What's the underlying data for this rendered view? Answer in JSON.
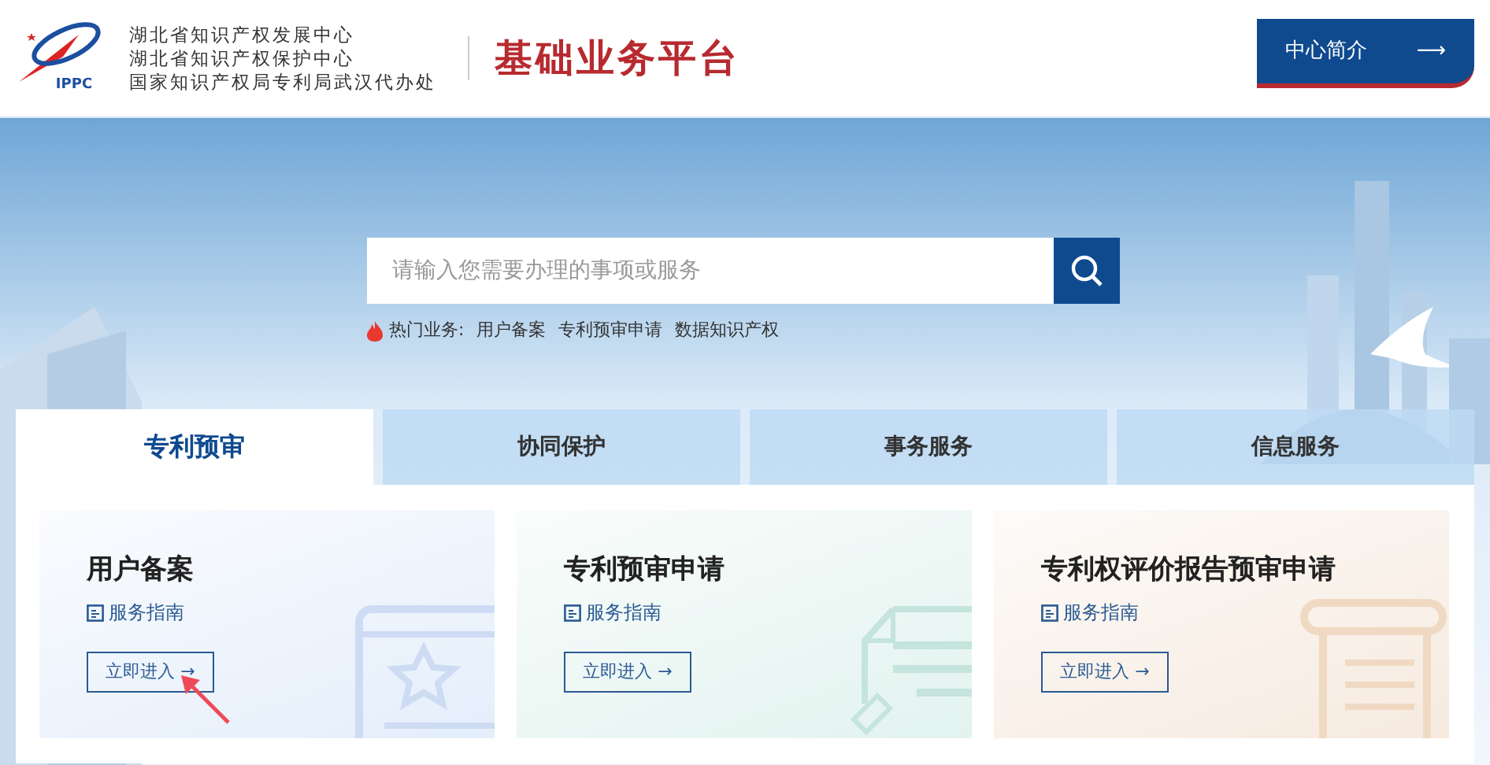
{
  "header": {
    "logo_text": "IPPC",
    "org_lines": [
      "湖北省知识产权发展中心",
      "湖北省知识产权保护中心",
      "国家知识产权局专利局武汉代办处"
    ],
    "platform_title": "基础业务平台",
    "intro_button": "中心简介",
    "intro_arrow": "⟶"
  },
  "search": {
    "placeholder": "请输入您需要办理的事项或服务"
  },
  "hot": {
    "label": "热门业务:",
    "links": [
      "用户备案",
      "专利预审申请",
      "数据知识产权"
    ]
  },
  "tabs": [
    {
      "label": "专利预审",
      "selected": true
    },
    {
      "label": "协同保护",
      "selected": false
    },
    {
      "label": "事务服务",
      "selected": false
    },
    {
      "label": "信息服务",
      "selected": false
    }
  ],
  "cards": [
    {
      "title": "用户备案",
      "guide": "服务指南",
      "action": "立即进入 →",
      "kind": "calendar",
      "color": "#e4eefb"
    },
    {
      "title": "专利预审申请",
      "guide": "服务指南",
      "action": "立即进入 →",
      "kind": "document",
      "color": "#e2f3ef"
    },
    {
      "title": "专利权评价报告预审申请",
      "guide": "服务指南",
      "action": "立即进入 →",
      "kind": "scroll",
      "color": "#f6eadf"
    }
  ]
}
